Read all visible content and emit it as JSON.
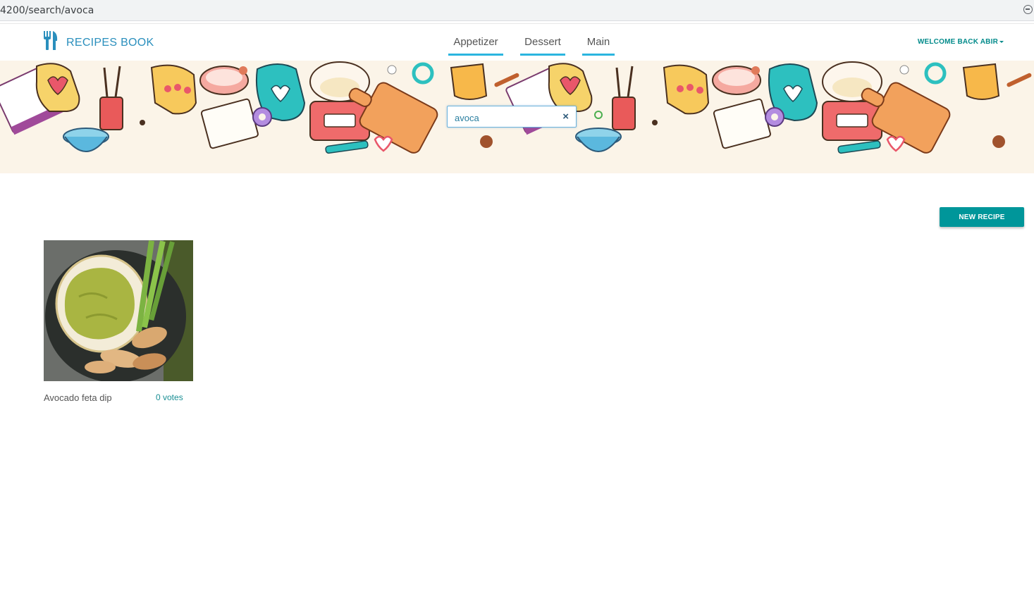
{
  "browser": {
    "url": "4200/search/avoca"
  },
  "header": {
    "brand": "RECIPES BOOK",
    "nav": [
      {
        "label": "Appetizer"
      },
      {
        "label": "Dessert"
      },
      {
        "label": "Main"
      }
    ],
    "welcome": "WELCOME BACK ABIR"
  },
  "search": {
    "value": "avoca",
    "clear_label": "×"
  },
  "actions": {
    "new_recipe": "NEW RECIPE"
  },
  "results": [
    {
      "title": "Avocado feta dip",
      "votes": "0 votes"
    }
  ],
  "colors": {
    "brand": "#2a8fbd",
    "accent": "#00969a",
    "nav_underline": "#2bb5df"
  },
  "icons": [
    "fork-knife-icon",
    "close-icon",
    "search-icon",
    "zoom-icon",
    "caret-down-icon"
  ]
}
